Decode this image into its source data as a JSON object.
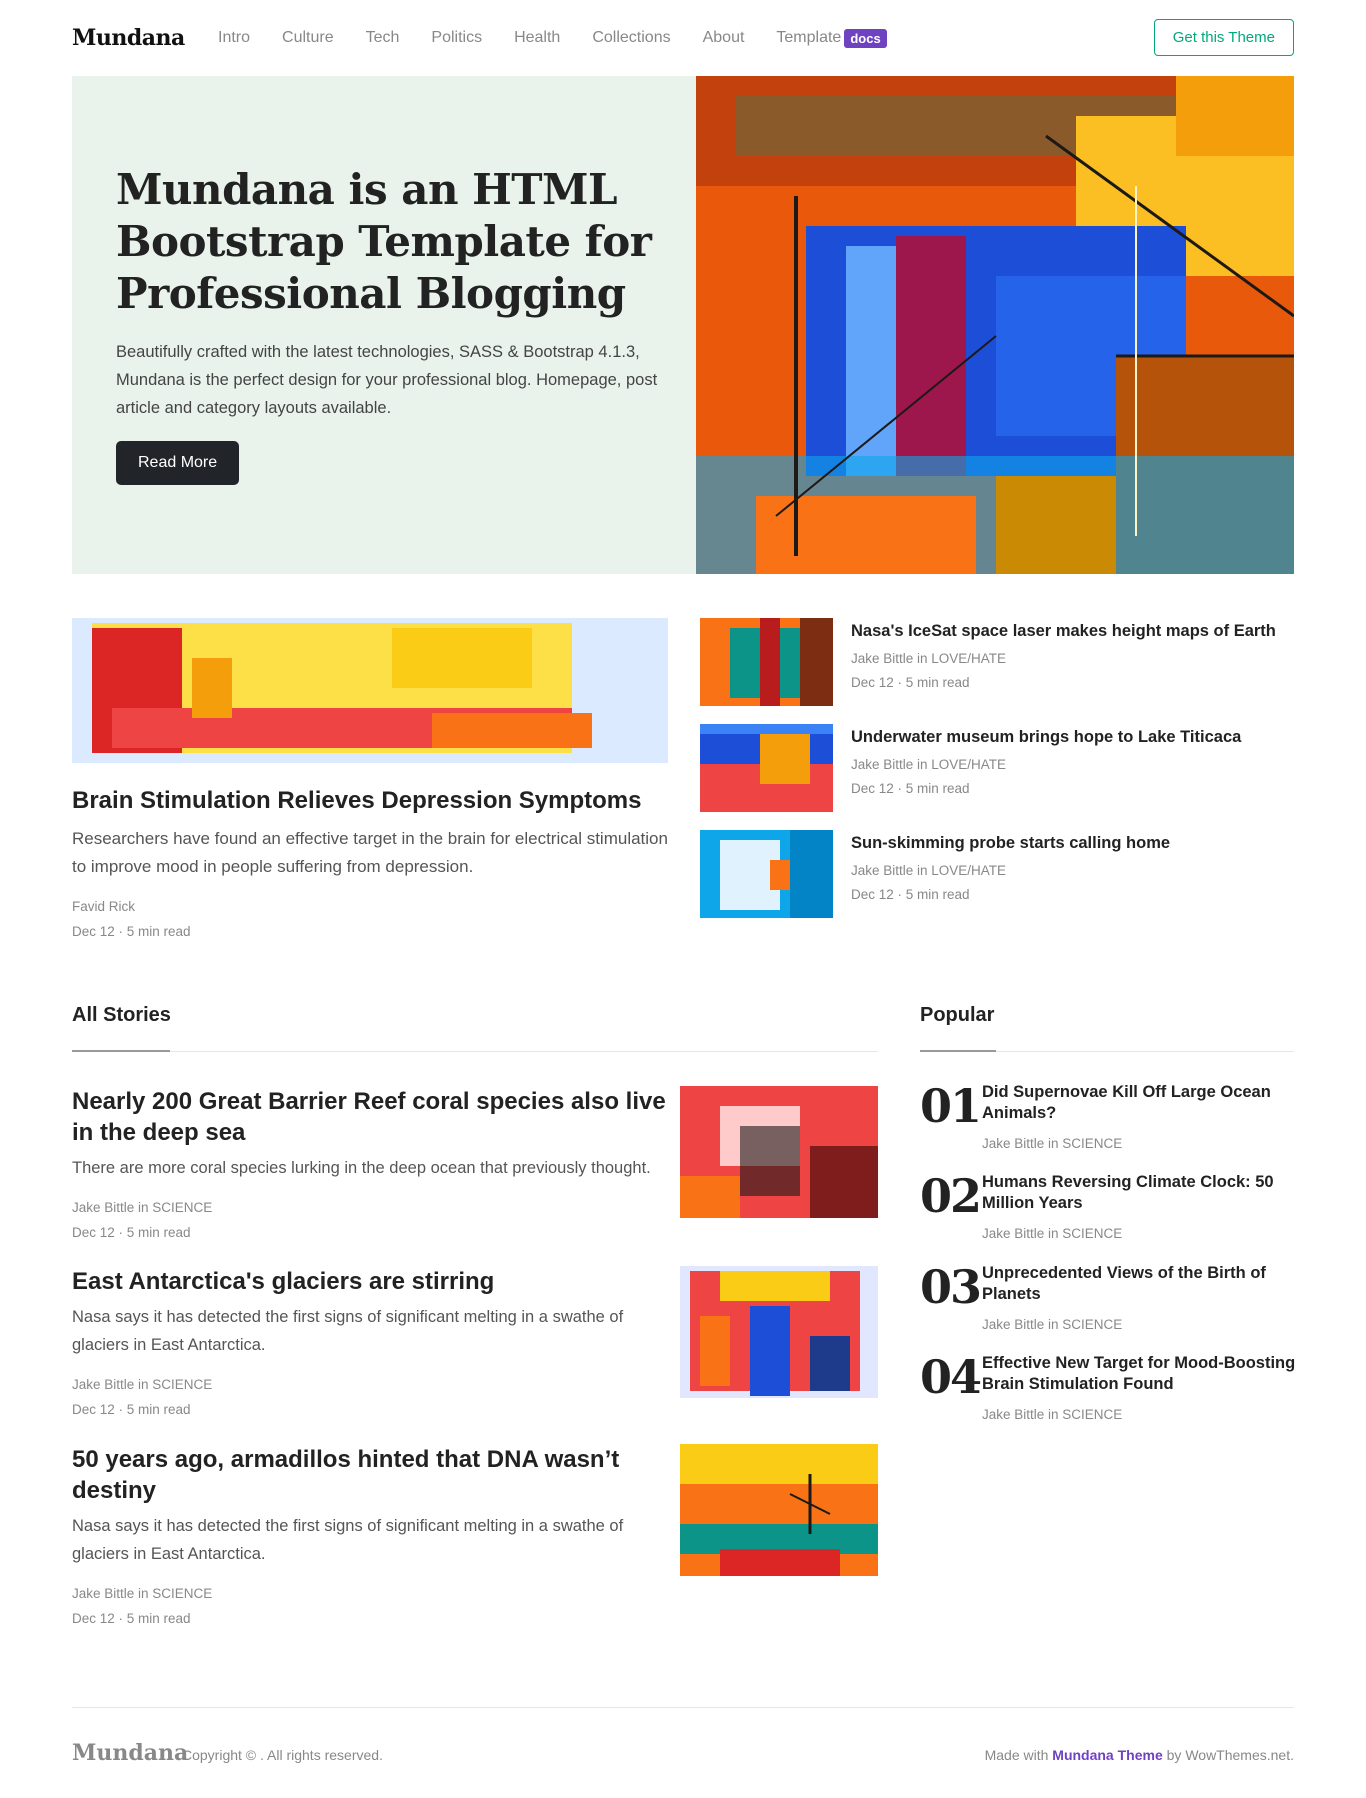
{
  "header": {
    "brand": "Mundana",
    "menu": [
      "Intro",
      "Culture",
      "Tech",
      "Politics",
      "Health",
      "Collections",
      "About"
    ],
    "template_label": "Template",
    "template_badge": "docs",
    "cta": "Get this Theme"
  },
  "hero": {
    "title": "Mundana is an HTML Bootstrap Template for Professional Blogging",
    "description": "Beautifully crafted with the latest technologies, SASS & Bootstrap 4.1.3, Mundana is the perfect design for your professional blog. Homepage, post article and category layouts available.",
    "button": "Read More"
  },
  "featured": {
    "title": "Brain Stimulation Relieves Depression Symptoms",
    "description": "Researchers have found an effective target in the brain for electrical stimulation to improve mood in people suffering from depression.",
    "author": "Favid Rick",
    "date": "Dec 12 · 5 min read"
  },
  "side_posts": [
    {
      "title": "Nasa's IceSat space laser makes height maps of Earth",
      "author": "Jake Bittle in LOVE/HATE",
      "date": "Dec 12 · 5 min read"
    },
    {
      "title": "Underwater museum brings hope to Lake Titicaca",
      "author": "Jake Bittle in LOVE/HATE",
      "date": "Dec 12 · 5 min read"
    },
    {
      "title": "Sun-skimming probe starts calling home",
      "author": "Jake Bittle in LOVE/HATE",
      "date": "Dec 12 · 5 min read"
    }
  ],
  "all_stories": {
    "heading": "All Stories",
    "items": [
      {
        "title": "Nearly 200 Great Barrier Reef coral species also live in the deep sea",
        "description": "There are more coral species lurking in the deep ocean that previously thought.",
        "author": "Jake Bittle in SCIENCE",
        "date": "Dec 12 · 5 min read"
      },
      {
        "title": "East Antarctica's glaciers are stirring",
        "description": "Nasa says it has detected the first signs of significant melting in a swathe of glaciers in East Antarctica.",
        "author": "Jake Bittle in SCIENCE",
        "date": "Dec 12 · 5 min read"
      },
      {
        "title": "50 years ago, armadillos hinted that DNA wasn’t destiny",
        "description": "Nasa says it has detected the first signs of significant melting in a swathe of glaciers in East Antarctica.",
        "author": "Jake Bittle in SCIENCE",
        "date": "Dec 12 · 5 min read"
      }
    ]
  },
  "popular": {
    "heading": "Popular",
    "items": [
      {
        "num": "01",
        "title": "Did Supernovae Kill Off Large Ocean Animals?",
        "author": "Jake Bittle in SCIENCE"
      },
      {
        "num": "02",
        "title": "Humans Reversing Climate Clock: 50 Million Years",
        "author": "Jake Bittle in SCIENCE"
      },
      {
        "num": "03",
        "title": "Unprecedented Views of the Birth of Planets",
        "author": "Jake Bittle in SCIENCE"
      },
      {
        "num": "04",
        "title": "Effective New Target for Mood-Boosting Brain Stimulation Found",
        "author": "Jake Bittle in SCIENCE"
      }
    ]
  },
  "footer": {
    "brand": "Mundana",
    "copyright": "Copyright © . All rights reserved.",
    "made_prefix": "Made with",
    "made_link": "Mundana Theme",
    "made_suffix": "by WowThemes.net."
  },
  "colors": {
    "accent_green": "#03a87c",
    "badge_purple": "#6f42c1",
    "hero_bg": "#e9f3ec",
    "button_dark": "#212529"
  }
}
